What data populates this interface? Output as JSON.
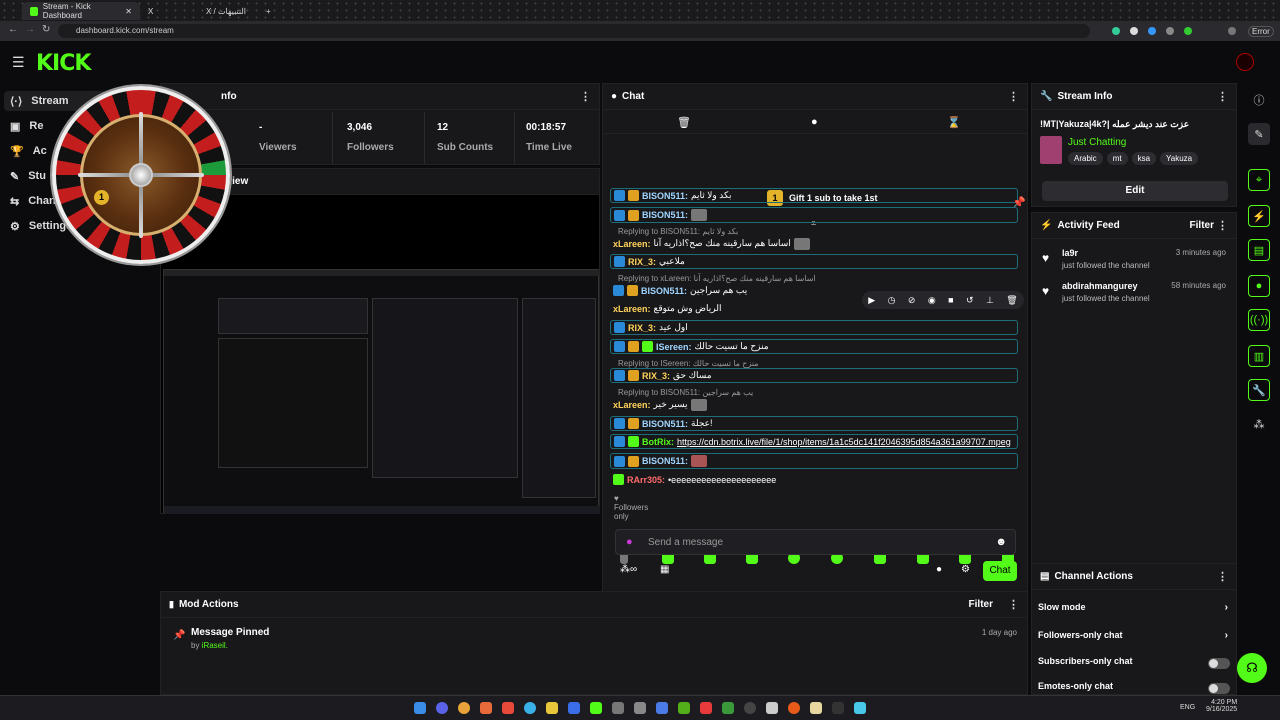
{
  "browser": {
    "tabs": [
      {
        "label": "Stream - Kick Dashboard"
      },
      {
        "label": "X"
      },
      {
        "label": "X / التنبيهات"
      }
    ],
    "url": "dashboard.kick.com/stream",
    "profile_label": "Error"
  },
  "app": {
    "logo": "KICK",
    "sidebar": [
      {
        "label": "Stream"
      },
      {
        "label": "Re"
      },
      {
        "label": "Ac"
      },
      {
        "label": "Stu"
      },
      {
        "label": "Channe"
      },
      {
        "label": "Settings"
      }
    ]
  },
  "session": {
    "title": "nfo",
    "stats": [
      {
        "value": "-",
        "label": "Viewers"
      },
      {
        "value": "3,046",
        "label": "Followers"
      },
      {
        "value": "12",
        "label": "Sub Counts"
      },
      {
        "value": "00:18:57",
        "label": "Time Live"
      }
    ],
    "preview_title": "eview"
  },
  "roulette": {
    "ball_number": "1"
  },
  "chat": {
    "title": "Chat",
    "goal": "Gift 1 sub to take 1st",
    "goal_rank": "1",
    "messages": [
      {
        "user": "BISON511:",
        "text": "بكد ولا ثايم"
      },
      {
        "user": "BISON511:",
        "text": ""
      },
      {
        "reply": "Replying to BISON511: بكد ولا ثايم",
        "user": "xLareen:",
        "text": "اساسا هم سارقينه منك صح؟اذاريه آنا"
      },
      {
        "user": "RIX_3:",
        "text": "ملاعبي"
      },
      {
        "reply": "Replying to xLareen: اساسا هم سارقينه منك صح؟اذاريه آنا",
        "user": "BISON511:",
        "text": "يب هم سراجين"
      },
      {
        "user": "xLareen:",
        "text": "الرياض وش متوقع"
      },
      {
        "user": "RIX_3:",
        "text": "اول عيد"
      },
      {
        "user": "ISereen:",
        "text": "منزح ما تسيت حالك"
      },
      {
        "reply": "Replying to ISereen: منزح ما تسيت حالك",
        "user": "RIX_3:",
        "text": "مساك حق"
      },
      {
        "reply": "Replying to BISON511: يب هم سراجين",
        "user": "xLareen:",
        "text": "يسير خير"
      },
      {
        "user": "BISON511:",
        "text": "عجلة!"
      },
      {
        "user": "BotRix:",
        "text": "https://cdn.botrix.live/file/1/shop/items/1a1c5dc141f2046395d854a361a99707.mpeg"
      },
      {
        "user": "BISON511:",
        "text": ""
      },
      {
        "user": "RArr305:",
        "text": "•eeeeeeeeeeeeeeeeeeeee"
      }
    ],
    "followers_only": "Followers only",
    "input_placeholder": "Send a message",
    "send_label": "Chat"
  },
  "stream_info": {
    "title": "Stream Info",
    "stream_title": "!MT|Yakuza|4k?| عزت عند ديشر عمله",
    "category": "Just Chatting",
    "tags": [
      "Arabic",
      "mt",
      "ksa",
      "Yakuza"
    ],
    "edit_label": "Edit"
  },
  "activity": {
    "title": "Activity Feed",
    "filter_label": "Filter",
    "items": [
      {
        "user": "la9r",
        "action": "just followed the channel",
        "time": "3 minutes ago"
      },
      {
        "user": "abdirahmangurey",
        "action": "just followed the channel",
        "time": "58 minutes ago"
      }
    ]
  },
  "mod_actions": {
    "title": "Mod Actions",
    "filter_label": "Filter",
    "items": [
      {
        "title": "Message Pinned",
        "by": "by ",
        "by_user": "iRaseil.",
        "time": "1 day ago"
      }
    ]
  },
  "channel_actions": {
    "title": "Channel Actions",
    "items": [
      {
        "label": "Slow mode"
      },
      {
        "label": "Followers-only chat"
      },
      {
        "label": "Subscribers-only chat"
      },
      {
        "label": "Emotes-only chat"
      }
    ]
  },
  "taskbar": {
    "lang": "ENG",
    "time": "4:20 PM",
    "date": "9/16/2025"
  }
}
